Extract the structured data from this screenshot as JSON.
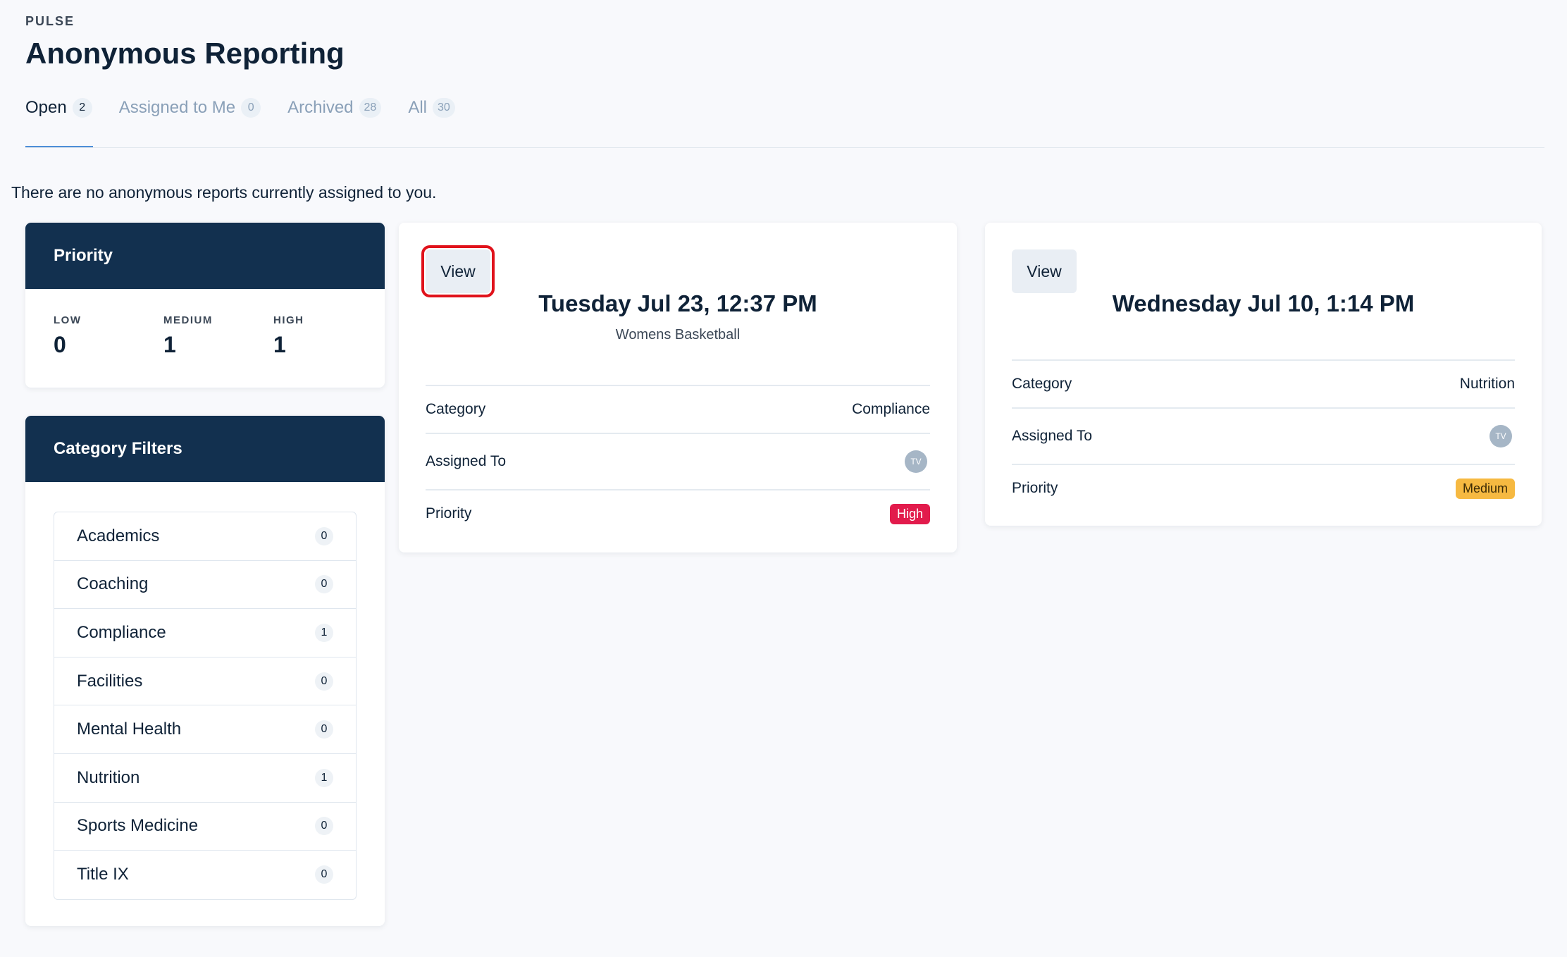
{
  "header": {
    "eyebrow": "PULSE",
    "title": "Anonymous Reporting"
  },
  "tabs": [
    {
      "label": "Open",
      "count": "2"
    },
    {
      "label": "Assigned to Me",
      "count": "0"
    },
    {
      "label": "Archived",
      "count": "28"
    },
    {
      "label": "All",
      "count": "30"
    }
  ],
  "empty_message": "There are no anonymous reports currently assigned to you.",
  "priority": {
    "title": "Priority",
    "low_label": "LOW",
    "low_value": "0",
    "medium_label": "MEDIUM",
    "medium_value": "1",
    "high_label": "HIGH",
    "high_value": "1"
  },
  "categories": {
    "title": "Category Filters",
    "items": [
      {
        "label": "Academics",
        "count": "0"
      },
      {
        "label": "Coaching",
        "count": "0"
      },
      {
        "label": "Compliance",
        "count": "1"
      },
      {
        "label": "Facilities",
        "count": "0"
      },
      {
        "label": "Mental Health",
        "count": "0"
      },
      {
        "label": "Nutrition",
        "count": "1"
      },
      {
        "label": "Sports Medicine",
        "count": "0"
      },
      {
        "label": "Title IX",
        "count": "0"
      }
    ]
  },
  "reports": [
    {
      "view_label": "View",
      "date": "Tuesday Jul 23, 12:37 PM",
      "subtitle": "Womens Basketball",
      "category_label": "Category",
      "category_value": "Compliance",
      "assigned_label": "Assigned To",
      "assigned_initials": "TV",
      "priority_label": "Priority",
      "priority_value": "High"
    },
    {
      "view_label": "View",
      "date": "Wednesday Jul 10, 1:14 PM",
      "category_label": "Category",
      "category_value": "Nutrition",
      "assigned_label": "Assigned To",
      "assigned_initials": "TV",
      "priority_label": "Priority",
      "priority_value": "Medium"
    }
  ],
  "colors": {
    "panel_header": "#12304f",
    "badge_high": "#e21b4c",
    "badge_medium": "#f6b941",
    "tab_active_underline": "#4e8fd8",
    "highlight_outline": "#e0121b"
  }
}
